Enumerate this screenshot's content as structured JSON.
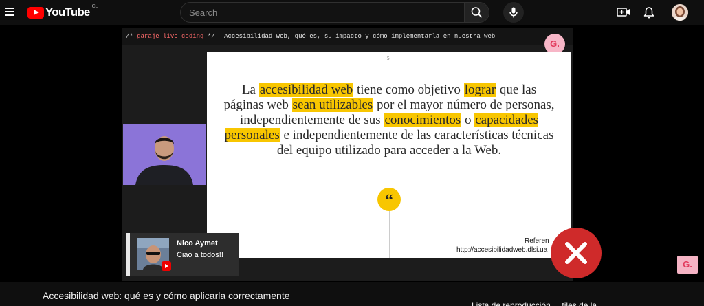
{
  "header": {
    "logo_text": "YouTube",
    "region_code": "CL",
    "search_placeholder": "Search"
  },
  "player": {
    "code_comment_open": "/*",
    "code_tag": "garaje live coding",
    "code_comment_close": "*/",
    "header_title": "Accesibilidad web, qué es, su impacto y cómo implementarla en nuestra web",
    "badge_letter": "G.",
    "slide": {
      "page_number": "5",
      "text_1": "La ",
      "hl_1": "accesibilidad web",
      "text_2": " tiene como objetivo ",
      "hl_2": "lograr",
      "text_3": " que las páginas web ",
      "hl_3": "sean utilizables",
      "text_4": " por el mayor número de personas, independientemente de sus ",
      "hl_4": "conocimientos",
      "text_5": " o ",
      "hl_5": "capacidades personales",
      "text_6": " e independientemente de las características técnicas del equipo utilizado para acceder a la Web.",
      "quote_mark": "“",
      "reference_label": "Referen",
      "reference_url": "http://accesibilidadweb.dlsi.ua"
    },
    "chat": {
      "author": "Nico Aymet",
      "message": "Ciao a todos!!"
    }
  },
  "corner_logo": "G.",
  "video_title": "Accesibilidad web: qué es y cómo aplicarla correctamente",
  "side_text_cut": "Lista de reproducción ... tiles de la ...",
  "colors": {
    "highlight": "#f8c600",
    "close_red": "#cf2a2a",
    "webcam_bg": "#8b74d8",
    "youtube_red": "#ff0000"
  }
}
